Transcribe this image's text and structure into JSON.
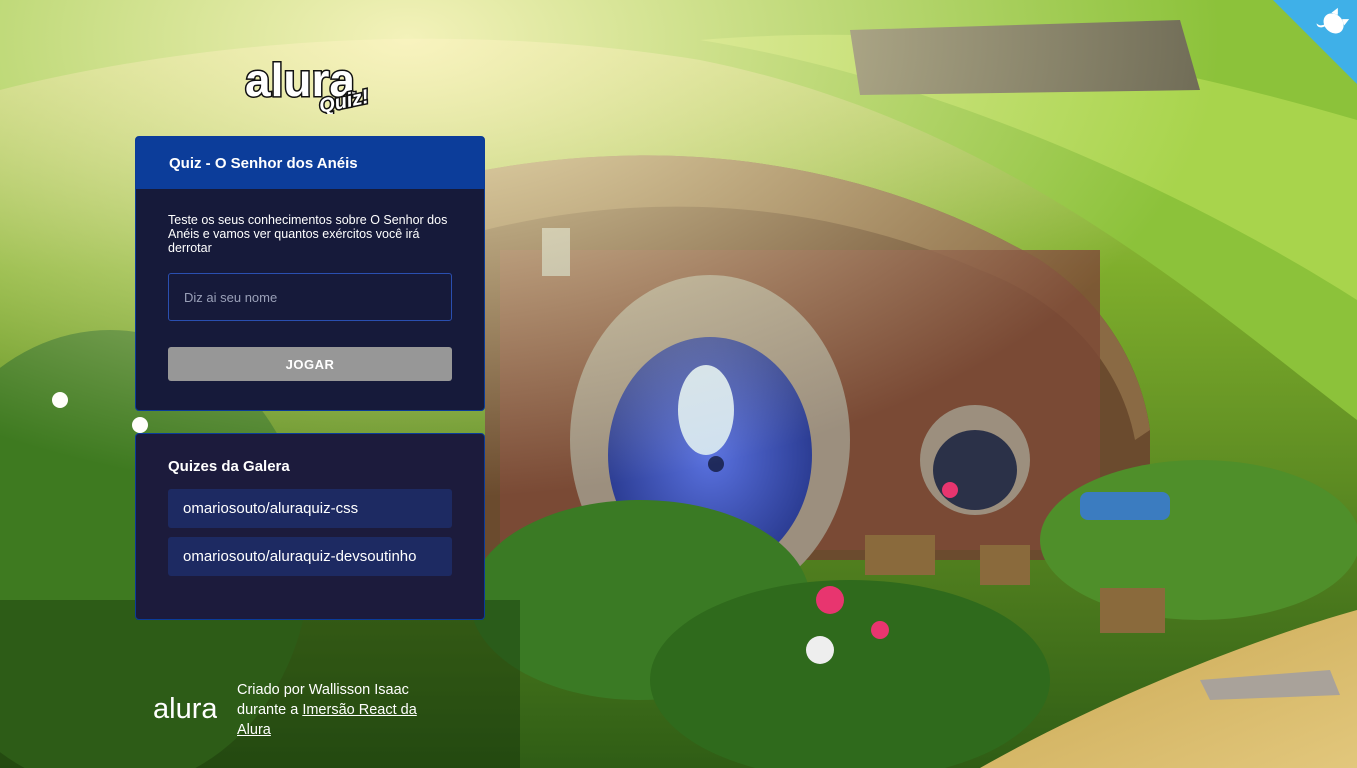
{
  "app": {
    "logo_word": "alura",
    "logo_badge": "Quiz!"
  },
  "quiz_widget": {
    "title": "Quiz - O Senhor dos Anéis",
    "description": "Teste os seus conhecimentos sobre O Senhor dos Anéis e vamos ver quantos exércitos você irá derrotar",
    "name_input": {
      "placeholder": "Diz ai seu nome",
      "value": ""
    },
    "play_label": "JOGAR"
  },
  "community_widget": {
    "title": "Quizes da Galera",
    "links": [
      {
        "label": "omariosouto/aluraquiz-css"
      },
      {
        "label": "omariosouto/aluraquiz-devsoutinho"
      }
    ]
  },
  "footer": {
    "logo_word": "alura",
    "text_before": "Criado por Wallisson Isaac durante a ",
    "link_text": "Imersão React da Alura"
  },
  "colors": {
    "widget_header": "#0c3d9a",
    "widget_body": "#161a3a",
    "link_bg": "#1d2a62",
    "button_disabled": "#979797",
    "github_corner": "#3fb0e8",
    "door": "#4a5fc8"
  },
  "icons": {
    "github_corner": "github-octocat-icon"
  }
}
